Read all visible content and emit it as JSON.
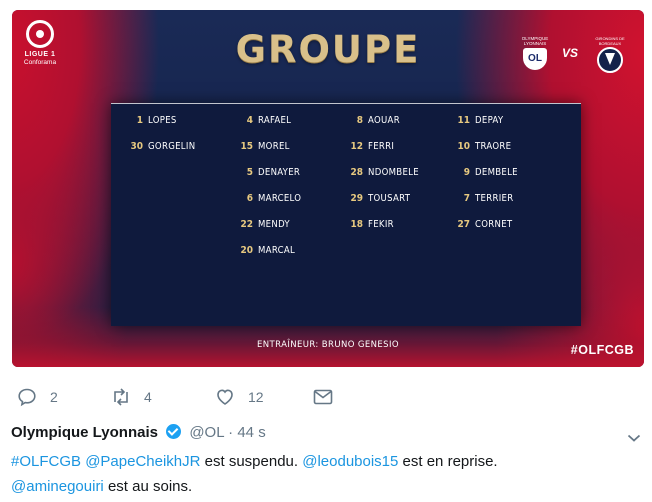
{
  "media": {
    "league_logo": {
      "line1": "LIGUE 1",
      "line2": "Conforama"
    },
    "title": "GROUPE",
    "match": {
      "home_crest_text": "OLYMPIQUE LYONNAIS",
      "home_crest_letters": "OL",
      "vs": "VS",
      "away_crest_text": "GIRONDINS DE BORDEAUX"
    },
    "columns": [
      [
        {
          "num": "1",
          "name": "LOPES"
        },
        {
          "num": "30",
          "name": "GORGELIN"
        }
      ],
      [
        {
          "num": "4",
          "name": "RAFAEL"
        },
        {
          "num": "15",
          "name": "MOREL"
        },
        {
          "num": "5",
          "name": "DENAYER"
        },
        {
          "num": "6",
          "name": "MARCELO"
        },
        {
          "num": "22",
          "name": "MENDY"
        },
        {
          "num": "20",
          "name": "MARCAL"
        }
      ],
      [
        {
          "num": "8",
          "name": "AOUAR"
        },
        {
          "num": "12",
          "name": "FERRI"
        },
        {
          "num": "28",
          "name": "NDOMBELE"
        },
        {
          "num": "29",
          "name": "TOUSART"
        },
        {
          "num": "18",
          "name": "FEKIR"
        }
      ],
      [
        {
          "num": "11",
          "name": "DEPAY"
        },
        {
          "num": "10",
          "name": "TRAORE"
        },
        {
          "num": "9",
          "name": "DEMBELE"
        },
        {
          "num": "7",
          "name": "TERRIER"
        },
        {
          "num": "27",
          "name": "CORNET"
        }
      ]
    ],
    "coach": "ENTRAÎNEUR: BRUNO GENESIO",
    "hashtag": "#OLFCGB"
  },
  "actions": {
    "reply": {
      "icon": "reply-icon",
      "count": "2"
    },
    "retweet": {
      "icon": "retweet-icon",
      "count": "4"
    },
    "like": {
      "icon": "heart-icon",
      "count": "12"
    },
    "message": {
      "icon": "envelope-icon"
    }
  },
  "tweet": {
    "name": "Olympique Lyonnais",
    "handle": "@OL",
    "separator": "·",
    "time": "44 s",
    "segments": [
      {
        "text": "#OLFCGB",
        "link": true
      },
      {
        "text": " ",
        "link": false
      },
      {
        "text": "@PapeCheikhJR",
        "link": true
      },
      {
        "text": " est suspendu. ",
        "link": false
      },
      {
        "text": "@leodubois15",
        "link": true
      },
      {
        "text": " est en reprise.",
        "link": false
      },
      {
        "text": "@aminegouiri",
        "link": true,
        "newline": true
      },
      {
        "text": " est au soins.",
        "link": false
      }
    ]
  },
  "colors": {
    "accent_red": "#c8102e",
    "navy": "#14224a",
    "gold": "#d9c08a",
    "link": "#1b95e0",
    "grey": "#657786"
  }
}
